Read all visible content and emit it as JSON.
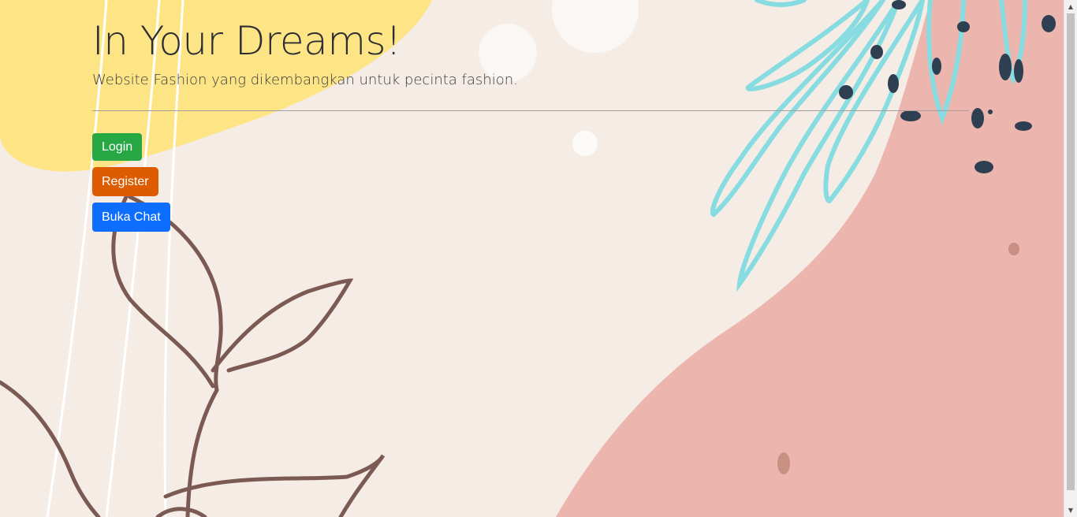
{
  "jumbotron": {
    "title": "In Your Dreams!",
    "subtitle": "Website Fashion yang dikembangkan untuk pecinta fashion."
  },
  "buttons": {
    "login": "Login",
    "register": "Register",
    "chat": "Buka Chat"
  },
  "colors": {
    "background": "#f5ece5",
    "yellow_blob": "#fde585",
    "pink_blob": "#ecb5ae",
    "leaf_brown": "#7a5a52",
    "leaf_cyan": "#86dce0",
    "dots_navy": "#2f3f52",
    "login_button": "#28a745",
    "register_button": "#de5c00",
    "chat_button": "#0d6efd"
  },
  "scrollbar": {
    "up_icon": "triangle-up",
    "down_icon": "triangle-down"
  }
}
